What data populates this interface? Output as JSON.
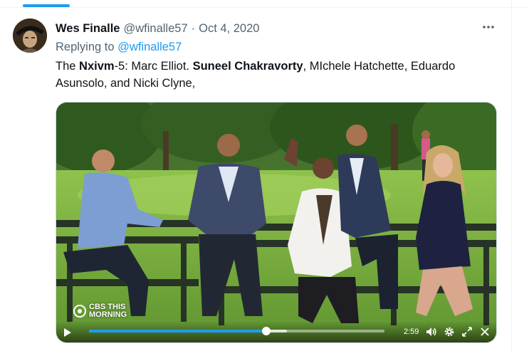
{
  "tweet": {
    "author_name": "Wes Finalle",
    "author_handle": "@wfinalle57",
    "separator": "·",
    "date": "Oct 4, 2020",
    "more_icon": "more-horizontal-icon",
    "reply_prefix": "Replying to",
    "reply_handle": "@wfinalle57",
    "text_parts": {
      "p1": "The ",
      "b1": "Nxivm",
      "p2": "-5: Marc Elliot. ",
      "b2": "Suneel Chakravorty",
      "p3": ", MIchele Hatchette, Eduardo Asunsolo, and Nicki Clyne,"
    }
  },
  "media": {
    "watermark_line1": "CBS THIS",
    "watermark_line2": "MORNING",
    "player": {
      "time_remaining": "2:59",
      "progress": 0.6,
      "buffered": 0.67,
      "icons": [
        "play-icon",
        "volume-icon",
        "settings-icon",
        "fullscreen-icon",
        "close-icon"
      ]
    }
  },
  "colors": {
    "accent": "#1d9bf0",
    "text_primary": "#0f1419",
    "text_secondary": "#536471"
  }
}
